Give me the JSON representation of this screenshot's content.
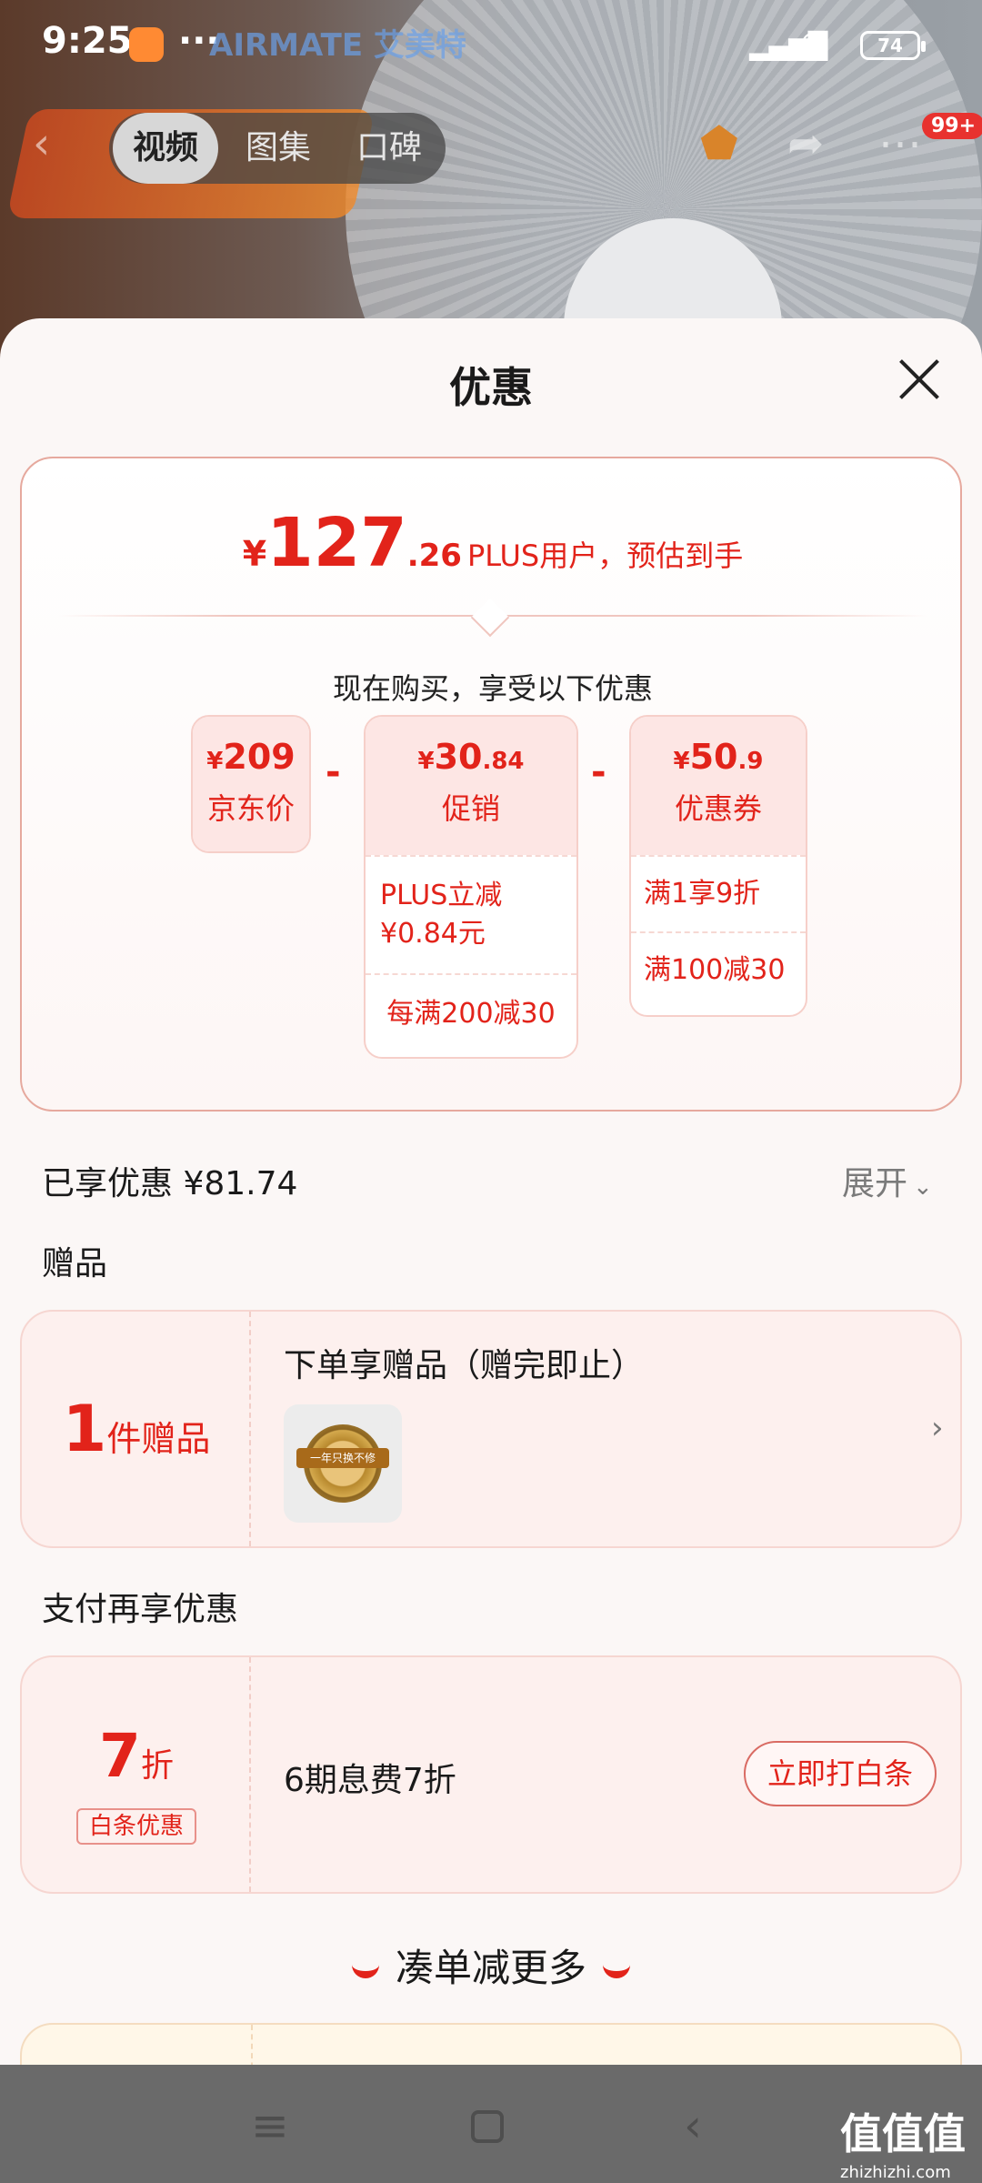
{
  "status": {
    "time": "9:25",
    "signal": "HD ull",
    "battery": "74"
  },
  "background": {
    "brand": "AIRMATE 艾美特",
    "tabs": [
      "视频",
      "图集",
      "口碑"
    ],
    "badge": "99+"
  },
  "sheet": {
    "title": "优惠",
    "final_price": {
      "currency": "¥",
      "integer": "127",
      "decimal": ".26",
      "note": "PLUS用户，预估到手"
    },
    "buy_now_text": "现在购买，享受以下优惠",
    "breakdown": [
      {
        "currency": "¥",
        "amount": "209",
        "decimal": "",
        "label": "京东价",
        "rows": []
      },
      {
        "currency": "¥",
        "amount": "30",
        "decimal": ".84",
        "label": "促销",
        "rows": [
          "PLUS立减 ¥0.84元",
          "每满200减30"
        ]
      },
      {
        "currency": "¥",
        "amount": "50",
        "decimal": ".9",
        "label": "优惠券",
        "rows": [
          "满1享9折",
          "满100减30"
        ]
      }
    ],
    "enjoyed": "已享优惠 ¥81.74",
    "expand": "展开",
    "gift_section": {
      "title": "赠品",
      "count": "1",
      "count_unit": "件赠品",
      "headline": "下单享赠品（赠完即止）",
      "thumb_caption": "一年只换不修"
    },
    "pay_section": {
      "title": "支付再享优惠",
      "discount": "7",
      "discount_unit": "折",
      "tag": "白条优惠",
      "desc": "6期息费7折",
      "button": "立即打白条"
    },
    "more": "凑单减更多"
  },
  "watermark": {
    "main": "值值值",
    "sub": "zhizhizhi.com"
  },
  "colors": {
    "accent": "#e2231a",
    "sheet_bg": "#fbf7f6",
    "card_bg": "#fdf0ee"
  }
}
